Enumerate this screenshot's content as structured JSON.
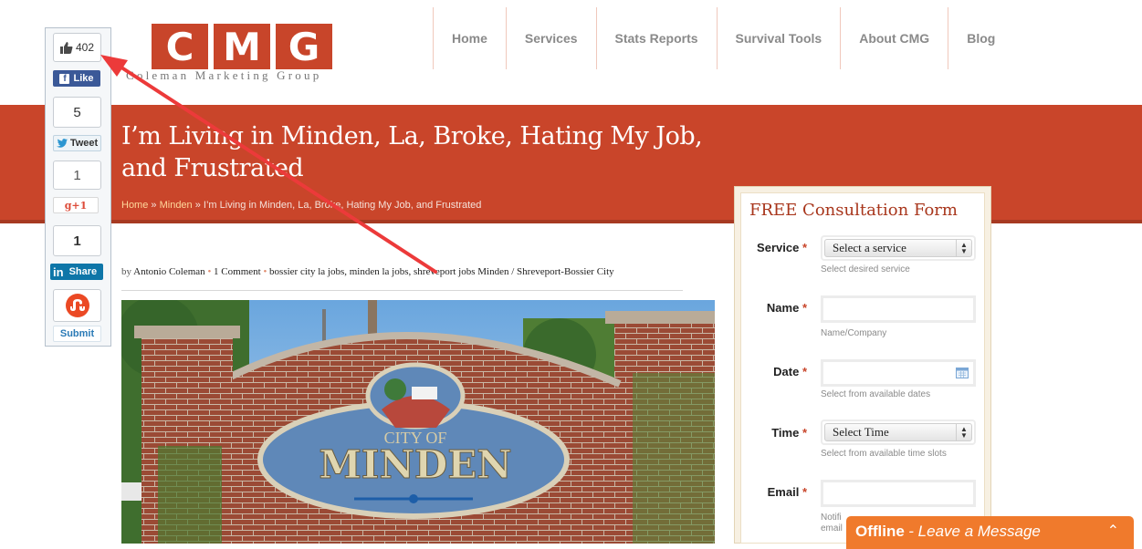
{
  "brand": {
    "letters": [
      "C",
      "M",
      "G"
    ],
    "tagline": "Coleman Marketing Group",
    "color": "#c8452a"
  },
  "nav": {
    "items": [
      {
        "label": "Home"
      },
      {
        "label": "Services"
      },
      {
        "label": "Stats Reports"
      },
      {
        "label": "Survival Tools"
      },
      {
        "label": "About CMG"
      },
      {
        "label": "Blog"
      }
    ]
  },
  "page": {
    "title": "I’m Living in Minden, La, Broke, Hating My Job, and Frustrated",
    "banner_color": "#c9452a",
    "breadcrumb": {
      "home": "Home",
      "sep": "»",
      "category": "Minden",
      "current": "I’m Living in Minden, La, Broke, Hating My Job, and Frustrated"
    },
    "meta": {
      "by": "by",
      "author": "Antonio Coleman",
      "comments": "1 Comment",
      "tags": "bossier city la jobs, minden la jobs, shreveport jobs",
      "categories": "Minden / Shreveport-Bossier City"
    },
    "image": {
      "sign_top": "CITY OF",
      "sign_main": "MINDEN"
    }
  },
  "social": {
    "facebook": {
      "count": "402",
      "button": "Like",
      "color": "#3b5998"
    },
    "twitter": {
      "count": "5",
      "button": "Tweet",
      "color": "#2c96d1"
    },
    "google": {
      "count": "1",
      "button": "+1",
      "color": "#dd4b39"
    },
    "linkedin": {
      "count": "1",
      "button": "Share",
      "color": "#0e76a8"
    },
    "stumbleupon": {
      "button": "Submit",
      "color": "#eb4924"
    }
  },
  "form": {
    "title": "FREE Consultation Form",
    "required_mark": "*",
    "fields": {
      "service": {
        "label": "Service",
        "value": "Select a service",
        "help": "Select desired service"
      },
      "name": {
        "label": "Name",
        "value": "",
        "help": "Name/Company"
      },
      "date": {
        "label": "Date",
        "value": "",
        "help": "Select from available dates"
      },
      "time": {
        "label": "Time",
        "value": "Select Time",
        "help": "Select from available time slots"
      },
      "email": {
        "label": "Email",
        "value": "",
        "help_line1": "Notifi",
        "help_line2": "email"
      }
    }
  },
  "chat": {
    "title": "Offline",
    "subtitle": "- Leave a Message",
    "color": "#f07a2c"
  },
  "annotation": {
    "color": "#ec3a3a"
  }
}
